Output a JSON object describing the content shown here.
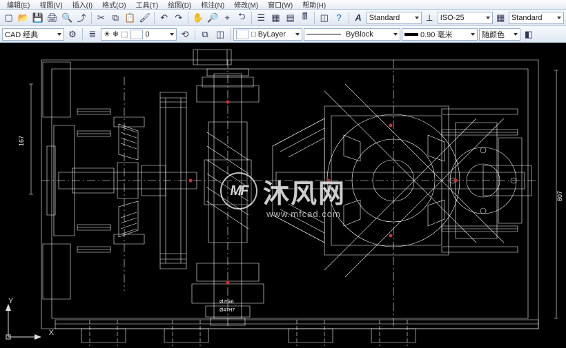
{
  "menubar": {
    "items": [
      "编辑(E)",
      "视图(V)",
      "插入(I)",
      "格式(O)",
      "工具(T)",
      "绘图(D)",
      "标注(N)",
      "修改(M)",
      "窗口(W)",
      "帮助(H)"
    ]
  },
  "toolbar1": {
    "text_style": {
      "label": "Standard"
    },
    "dim_style": {
      "label": "ISO-25"
    },
    "table_style": {
      "label": "Standard"
    }
  },
  "toolbar2": {
    "workspace": {
      "label": "CAD 经典"
    },
    "layer": {
      "label": "0"
    },
    "color": {
      "label": "□ ByLayer"
    },
    "linetype": {
      "label": "ByBlock"
    },
    "lineweight": {
      "label": "0.90 毫米"
    },
    "plotcolor": {
      "label": "随颜色"
    }
  },
  "axis": {
    "x": "X",
    "y": "Y"
  },
  "drawing": {
    "dim_left": "167",
    "dim_right": "807",
    "dim_small1": "Ø25k6",
    "dim_small2": "Ø47H7"
  },
  "watermark": {
    "badge": "MF",
    "text": "沐风网",
    "url": "www.mfcad.com"
  }
}
